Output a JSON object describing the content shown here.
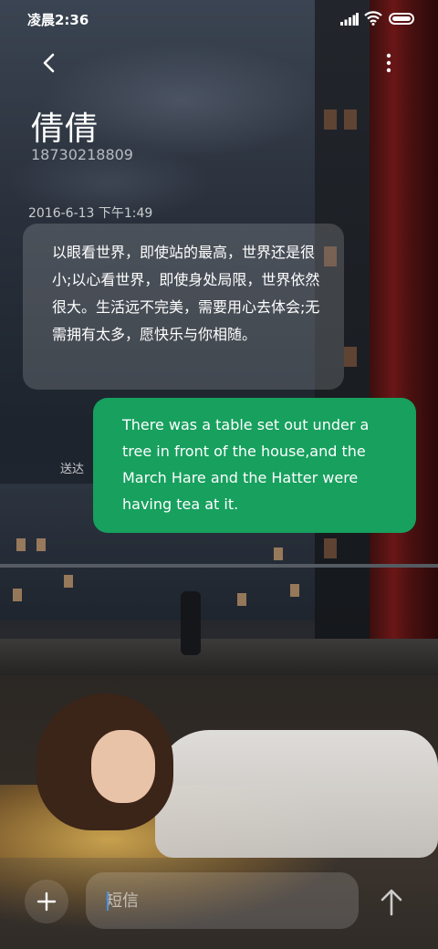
{
  "status_bar": {
    "time": "凌晨2:36",
    "signal_icon": "signal-icon",
    "wifi_icon": "wifi-icon",
    "battery_icon": "battery-icon"
  },
  "header": {
    "back_icon": "back-icon",
    "more_icon": "more-vertical-icon",
    "contact_name": "倩倩",
    "contact_number": "18730218809"
  },
  "conversation": {
    "timestamp": "2016-6-13 下午1:49",
    "incoming_message": "以眼看世界，即使站的最高，世界还是很小;以心看世界，即使身处局限，世界依然很大。生活远不完美，需要用心去体会;无需拥有太多，愿快乐与你相随。",
    "outgoing_message": "There was a table set out under a tree in front of the house,and the March Hare and the Hatter were having tea at it.",
    "outgoing_status": "送达"
  },
  "composer": {
    "placeholder": "短信",
    "value": "",
    "add_icon": "plus-icon",
    "send_icon": "send-arrow-icon"
  },
  "colors": {
    "outgoing_bubble": "#17a05e",
    "incoming_bubble": "rgba(255,255,255,0.16)",
    "caret": "#4a90e2"
  }
}
